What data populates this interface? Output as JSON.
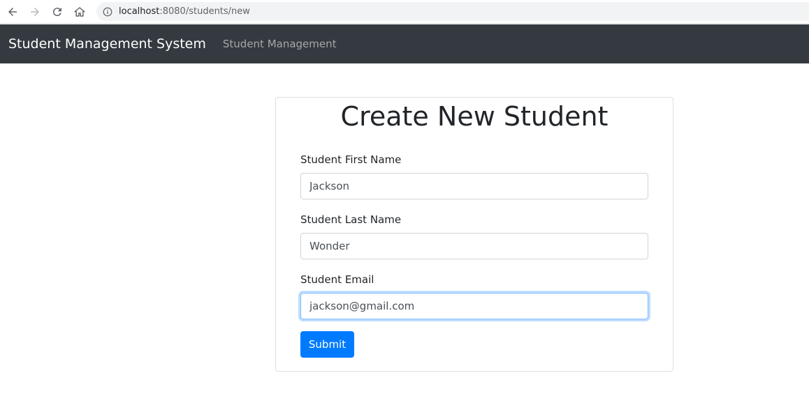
{
  "browser": {
    "url_host": "localhost",
    "url_path": ":8080/students/new",
    "icons": [
      "back-arrow-icon",
      "forward-arrow-icon",
      "reload-icon",
      "home-icon",
      "info-icon"
    ]
  },
  "navbar": {
    "brand": "Student Management System",
    "link": "Student Management",
    "background": "#343a40"
  },
  "form": {
    "title": "Create New Student",
    "first_name_label": "Student First Name",
    "first_name_value": "Jackson",
    "last_name_label": "Student Last Name",
    "last_name_value": "Wonder",
    "email_label": "Student Email",
    "email_value": "jackson@gmail.com",
    "submit_label": "Submit",
    "accent": "#007bff"
  }
}
